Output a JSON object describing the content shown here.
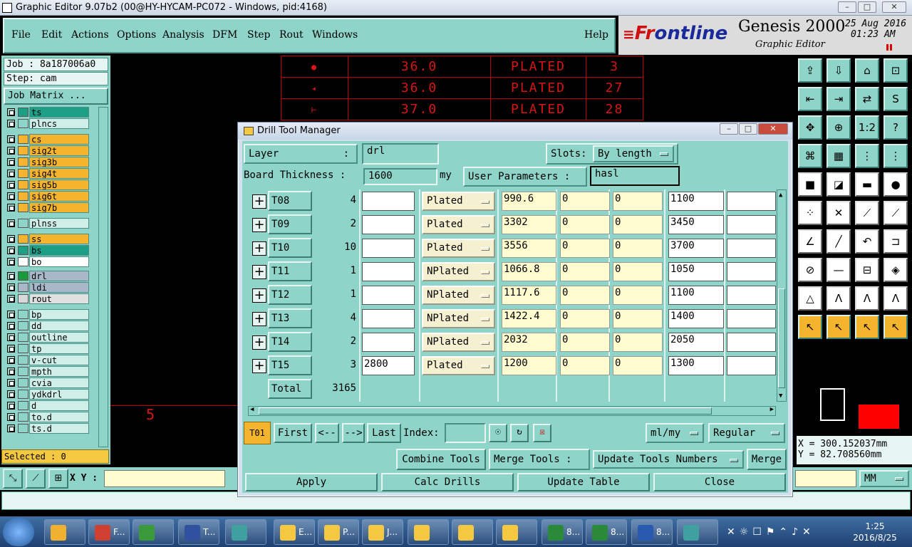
{
  "window": {
    "title": "Graphic Editor 9.07b2 (00@HY-HYCAM-PC072 - Windows, pid:4168)"
  },
  "menu": [
    "File",
    "Edit",
    "Actions",
    "Options",
    "Analysis",
    "DFM",
    "Step",
    "Rout",
    "Windows"
  ],
  "help": "Help",
  "brand": {
    "logo_a": "Fr",
    "logo_b": "ontline",
    "product": "Genesis 2000",
    "subtitle": "Graphic Editor",
    "date": "25 Aug 2016",
    "time": "01:23 AM"
  },
  "job": {
    "job_label": "Job : 8a187006a0",
    "step_label": "Step: cam",
    "matrix_button": "Job Matrix ..."
  },
  "layers": [
    {
      "name": "ts",
      "color": "#1d9f86",
      "nameBg": "#1d9f86"
    },
    {
      "name": "plncs",
      "color": "#8fd4c8",
      "nameBg": "#cfeee8"
    },
    {
      "name": "cs",
      "color": "#f5b42e",
      "nameBg": "#f5b42e"
    },
    {
      "name": "sig2t",
      "color": "#f5b42e",
      "nameBg": "#f5b42e"
    },
    {
      "name": "sig3b",
      "color": "#f5b42e",
      "nameBg": "#f5b42e"
    },
    {
      "name": "sig4t",
      "color": "#f5b42e",
      "nameBg": "#f5b42e"
    },
    {
      "name": "sig5b",
      "color": "#f5b42e",
      "nameBg": "#f5b42e"
    },
    {
      "name": "sig6t",
      "color": "#f5b42e",
      "nameBg": "#f5b42e"
    },
    {
      "name": "sig7b",
      "color": "#f5b42e",
      "nameBg": "#f5b42e"
    },
    {
      "name": "plnss",
      "color": "#8fd4c8",
      "nameBg": "#cfeee8"
    },
    {
      "name": "ss",
      "color": "#f5b42e",
      "nameBg": "#f5b42e"
    },
    {
      "name": "bs",
      "color": "#1d9f86",
      "nameBg": "#1d9f86"
    },
    {
      "name": "bo",
      "color": "#ffffff",
      "nameBg": "#ffffff"
    },
    {
      "name": "drl",
      "color": "#1a9a3a",
      "nameBg": "#a8b8c8"
    },
    {
      "name": "ldi",
      "color": "#a8b8c8",
      "nameBg": "#a8b8c8"
    },
    {
      "name": "rout",
      "color": "#d8d8d8",
      "nameBg": "#e0e0e0"
    },
    {
      "name": "bp",
      "color": "#8fd4c8",
      "nameBg": "#cfeee8"
    },
    {
      "name": "dd",
      "color": "#8fd4c8",
      "nameBg": "#cfeee8"
    },
    {
      "name": "outline",
      "color": "#8fd4c8",
      "nameBg": "#cfeee8"
    },
    {
      "name": "tp",
      "color": "#8fd4c8",
      "nameBg": "#cfeee8"
    },
    {
      "name": "v-cut",
      "color": "#8fd4c8",
      "nameBg": "#cfeee8"
    },
    {
      "name": "mpth",
      "color": "#8fd4c8",
      "nameBg": "#cfeee8"
    },
    {
      "name": "cvia",
      "color": "#8fd4c8",
      "nameBg": "#cfeee8"
    },
    {
      "name": "ydkdrl",
      "color": "#8fd4c8",
      "nameBg": "#cfeee8"
    },
    {
      "name": "d",
      "color": "#8fd4c8",
      "nameBg": "#cfeee8"
    },
    {
      "name": "to.d",
      "color": "#8fd4c8",
      "nameBg": "#cfeee8"
    },
    {
      "name": "ts.d",
      "color": "#8fd4c8",
      "nameBg": "#cfeee8"
    }
  ],
  "selected": "Selected : 0",
  "canvas_table": [
    {
      "size": "36.0",
      "type": "PLATED",
      "count": "3"
    },
    {
      "size": "36.0",
      "type": "PLATED",
      "count": "27"
    },
    {
      "size": "37.0",
      "type": "PLATED",
      "count": "28"
    }
  ],
  "canvas_label": "5",
  "dialog": {
    "title": "Drill Tool Manager",
    "layer_label": "Layer",
    "layer_colon": ":",
    "layer_value": "drl",
    "slots_label": "Slots:",
    "slots_value": "By length",
    "thickness_label": "Board Thickness  :",
    "thickness_value": "1600",
    "thickness_unit": "my",
    "user_params_label": "User Parameters :",
    "user_params_value": "hasl",
    "rows": [
      {
        "tool": "T08",
        "count": "4",
        "c1": "",
        "type": "Plated",
        "size": "990.6",
        "tol_minus": "0",
        "tol_plus": "0",
        "finish": "1100",
        "c7": ""
      },
      {
        "tool": "T09",
        "count": "2",
        "c1": "",
        "type": "Plated",
        "size": "3302",
        "tol_minus": "0",
        "tol_plus": "0",
        "finish": "3450",
        "c7": ""
      },
      {
        "tool": "T10",
        "count": "10",
        "c1": "",
        "type": "Plated",
        "size": "3556",
        "tol_minus": "0",
        "tol_plus": "0",
        "finish": "3700",
        "c7": ""
      },
      {
        "tool": "T11",
        "count": "1",
        "c1": "",
        "type": "NPlated",
        "size": "1066.8",
        "tol_minus": "0",
        "tol_plus": "0",
        "finish": "1050",
        "c7": ""
      },
      {
        "tool": "T12",
        "count": "1",
        "c1": "",
        "type": "NPlated",
        "size": "1117.6",
        "tol_minus": "0",
        "tol_plus": "0",
        "finish": "1100",
        "c7": ""
      },
      {
        "tool": "T13",
        "count": "4",
        "c1": "",
        "type": "NPlated",
        "size": "1422.4",
        "tol_minus": "0",
        "tol_plus": "0",
        "finish": "1400",
        "c7": ""
      },
      {
        "tool": "T14",
        "count": "2",
        "c1": "",
        "type": "NPlated",
        "size": "2032",
        "tol_minus": "0",
        "tol_plus": "0",
        "finish": "2050",
        "c7": ""
      },
      {
        "tool": "T15",
        "count": "3",
        "c1": "2800",
        "type": "Plated",
        "size": "1200",
        "tol_minus": "0",
        "tol_plus": "0",
        "finish": "1300",
        "c7": ""
      }
    ],
    "total_label": "Total",
    "total_value": "3165",
    "current_tool": "T01",
    "nav": {
      "first": "First",
      "prev": "<--",
      "next": "-->",
      "last": "Last",
      "index_label": "Index:"
    },
    "units_value": "ml/my",
    "mode_value": "Regular",
    "combine": "Combine Tools",
    "merge_label": "Merge Tools :",
    "merge_option": "Update Tools Numbers",
    "merge_button": "Merge",
    "apply": "Apply",
    "calc": "Calc Drills",
    "update": "Update Table",
    "close": "Close"
  },
  "coords": {
    "x": "X = 300.152037mm",
    "y": "Y = 82.708560mm"
  },
  "bottom": {
    "xy_label": "X Y :",
    "units": "MM"
  },
  "taskbar": {
    "items": [
      "F...",
      "",
      "T...",
      "",
      "E...",
      "P...",
      "J...",
      "",
      "",
      "",
      "8...",
      "8...",
      "8..."
    ],
    "time": "1:25",
    "date": "2016/8/25"
  }
}
